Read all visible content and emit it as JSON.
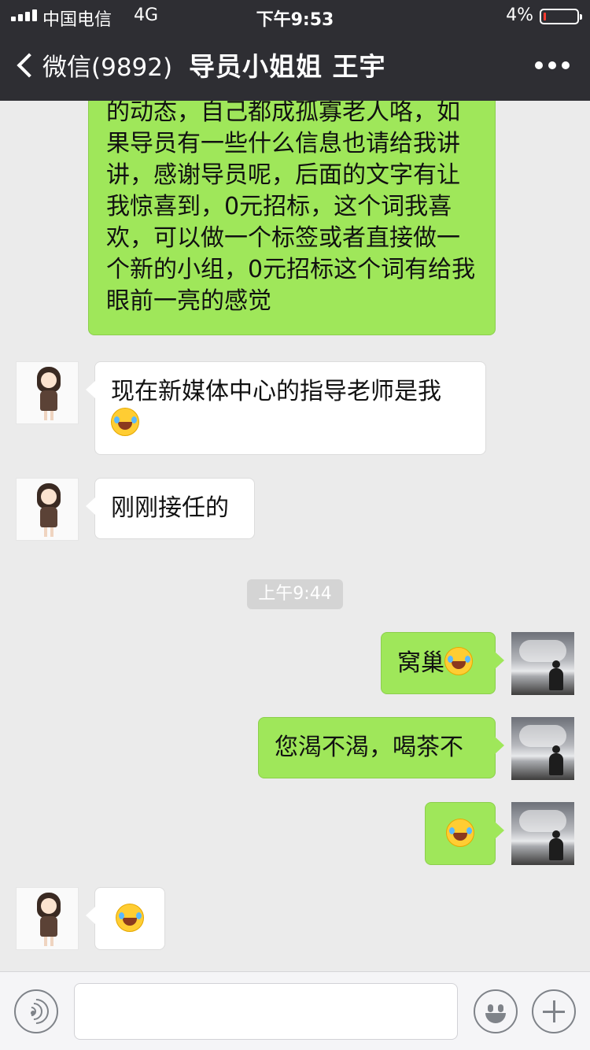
{
  "status_bar": {
    "carrier": "中国电信",
    "network": "4G",
    "time": "下午9:53",
    "battery": "4%"
  },
  "nav": {
    "back_label": "微信(9892)",
    "title": "导员小姐姐 王宇"
  },
  "messages": [
    {
      "sender": "me",
      "text": "的动态，自己都成孤寡老人咯，如果导员有一些什么信息也请给我讲讲，感谢导员呢，后面的文字有让我惊喜到，0元招标，这个词我喜欢，可以做一个标签或者直接做一个新的小组，0元招标这个词有给我眼前一亮的感觉"
    },
    {
      "sender": "other",
      "text": "现在新媒体中心的指导老师是我",
      "emoji": "face-with-tears-of-joy"
    },
    {
      "sender": "other",
      "text": "刚刚接任的"
    },
    {
      "timestamp": "上午9:44"
    },
    {
      "sender": "me",
      "text": "窝巢",
      "emoji": "face-with-tears-of-joy"
    },
    {
      "sender": "me",
      "text": "您渴不渴，喝茶不"
    },
    {
      "sender": "me",
      "emoji": "face-with-tears-of-joy"
    },
    {
      "sender": "other",
      "emoji": "face-with-tears-of-joy"
    }
  ],
  "input": {
    "placeholder": ""
  },
  "colors": {
    "nav_bg": "#2e2e33",
    "chat_bg": "#ebebeb",
    "my_bubble": "#9fe75a",
    "other_bubble": "#ffffff"
  }
}
